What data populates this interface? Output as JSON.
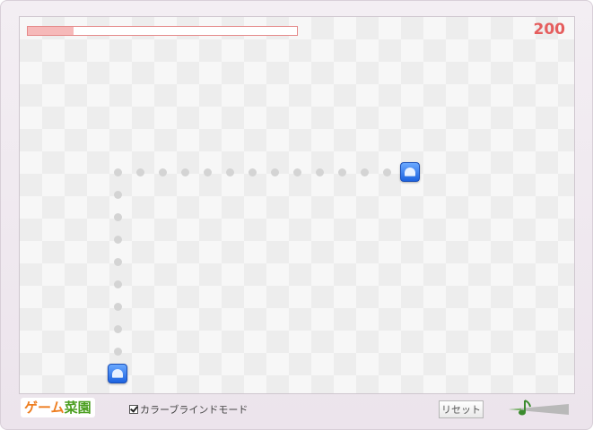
{
  "game": {
    "score": "200",
    "timer_fraction": 0.17
  },
  "footer": {
    "logo_part1": "ゲーム",
    "logo_part2": "菜園",
    "colorblind_label": "カラーブラインドモード",
    "colorblind_checked": true,
    "reset_label": "リセット"
  },
  "icons": {
    "sound": "music-note-icon",
    "tile": "blue-dome-tile-icon"
  },
  "colors": {
    "score": "#e55d5d",
    "tile": "#1d63e0",
    "path_dot": "#d4d4d4",
    "logo_orange": "#ee7d1f",
    "logo_green": "#4a9e1f"
  }
}
